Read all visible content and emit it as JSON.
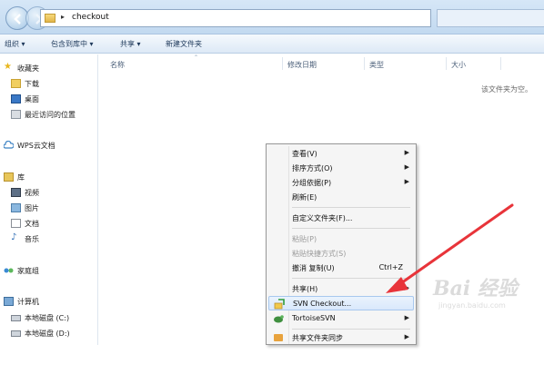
{
  "window": {
    "address_path": "checkout",
    "empty_folder_message": "该文件夹为空。"
  },
  "toolbar": {
    "organize": "组织 ▾",
    "include_in_library": "包含到库中 ▾",
    "share": "共享 ▾",
    "new_folder": "新建文件夹"
  },
  "sidebar": {
    "favorites": {
      "label": "收藏夹",
      "icon": "star-icon"
    },
    "favorites_items": [
      {
        "label": "下载",
        "icon": "download-folder-icon"
      },
      {
        "label": "桌面",
        "icon": "desktop-icon"
      },
      {
        "label": "最近访问的位置",
        "icon": "recent-places-icon"
      }
    ],
    "wps": {
      "label": "WPS云文档",
      "icon": "cloud-icon"
    },
    "libraries": {
      "label": "库",
      "icon": "library-icon"
    },
    "library_items": [
      {
        "label": "视频",
        "icon": "video-icon"
      },
      {
        "label": "图片",
        "icon": "picture-icon"
      },
      {
        "label": "文档",
        "icon": "document-icon"
      },
      {
        "label": "音乐",
        "icon": "music-icon"
      }
    ],
    "homegroup": {
      "label": "家庭组",
      "icon": "homegroup-icon"
    },
    "computer": {
      "label": "计算机",
      "icon": "computer-icon"
    },
    "computer_items": [
      {
        "label": "本地磁盘 (C:)",
        "icon": "drive-icon"
      },
      {
        "label": "本地磁盘 (D:)",
        "icon": "drive-icon"
      }
    ]
  },
  "columns": {
    "name": "名称",
    "modified": "修改日期",
    "type": "类型",
    "size": "大小"
  },
  "context_menu": {
    "view": "查看(V)",
    "sort_by": "排序方式(O)",
    "group_by": "分组依据(P)",
    "refresh": "刷新(E)",
    "customize": "自定义文件夹(F)...",
    "paste": "粘贴(P)",
    "paste_shortcut": "粘贴快捷方式(S)",
    "undo_copy": "撤消 复制(U)",
    "undo_shortcut": "Ctrl+Z",
    "share_with": "共享(H)",
    "svn_checkout": "SVN Checkout...",
    "tortoise_svn": "TortoiseSVN",
    "shared_folder_sync": "共享文件夹同步"
  },
  "watermark": {
    "logo": "Bai 经验",
    "url": "jingyan.baidu.com"
  },
  "colors": {
    "arrow": "#e8343a",
    "highlight": "#d9e8fb"
  }
}
